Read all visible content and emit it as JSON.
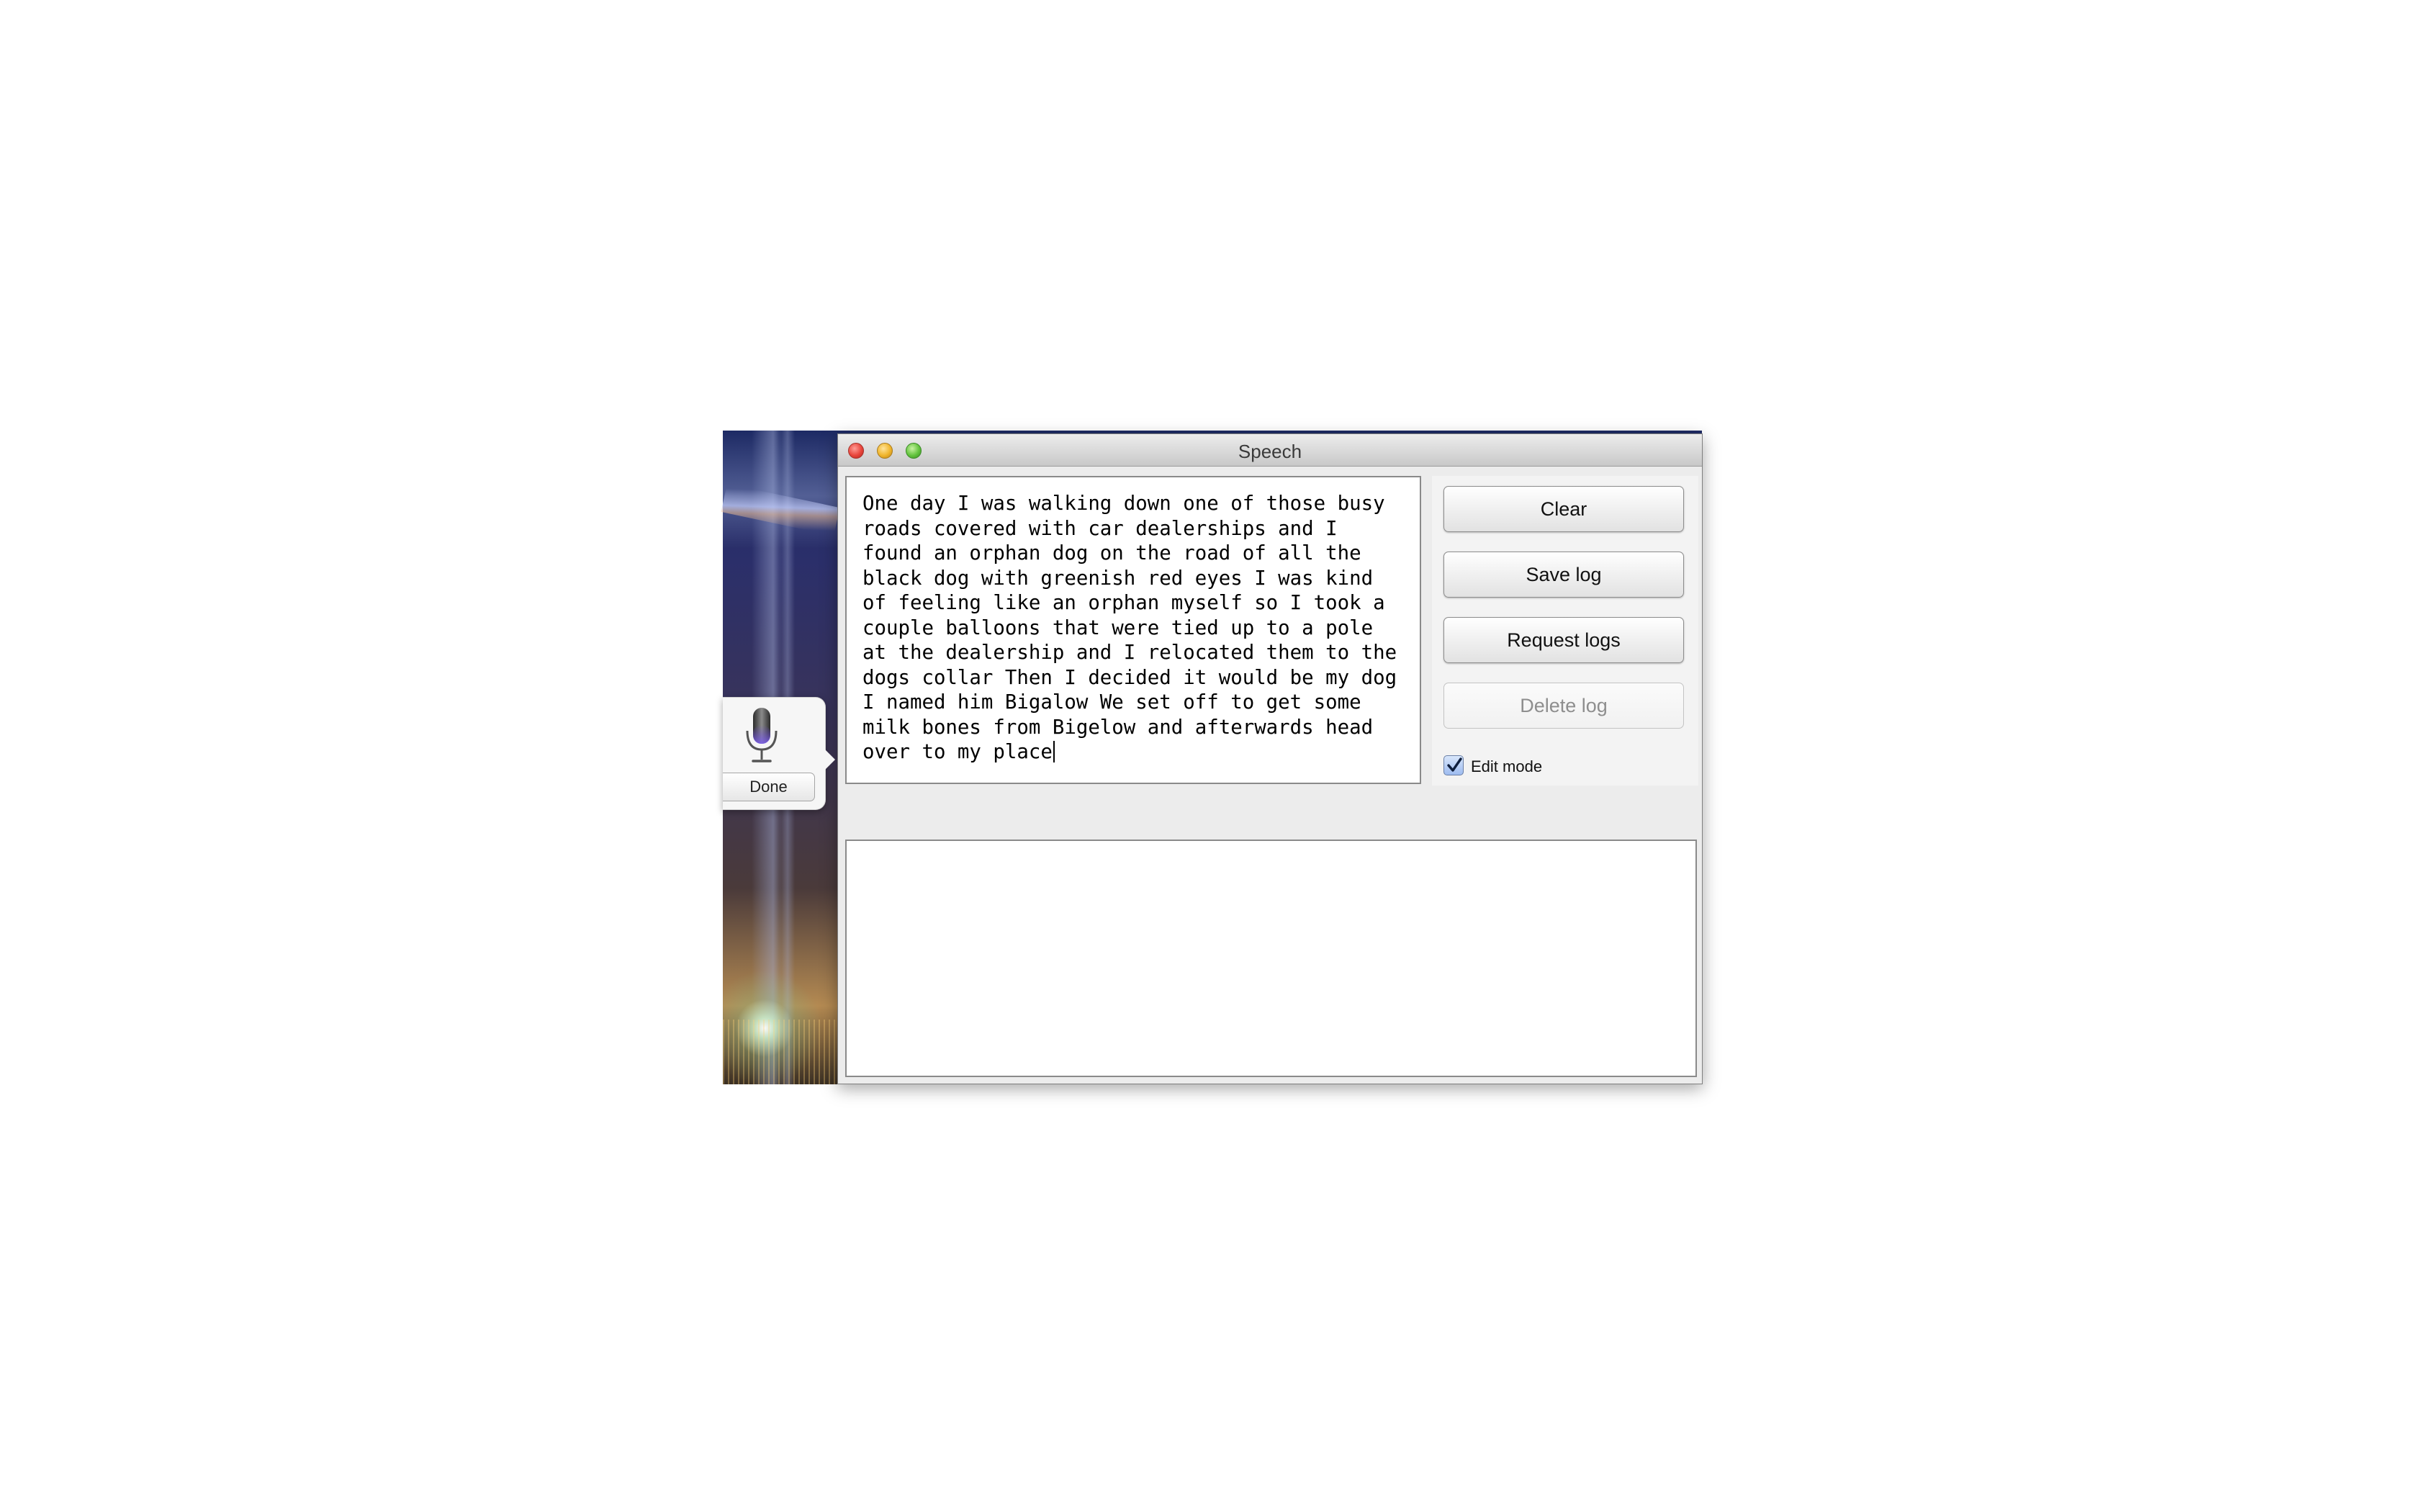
{
  "window": {
    "title": "Speech"
  },
  "editor": {
    "text": "One day I was walking down one of those busy roads covered with car dealerships and I found an orphan dog on the road of all the black dog with greenish red eyes I was kind of feeling like an orphan myself so I took a couple balloons that were tied up to a pole at the dealership and I relocated them to the dogs collar Then I decided it would be my dog I named him Bigalow We set off to get some milk bones from Bigelow and afterwards head over to my place"
  },
  "controls": {
    "clear_label": "Clear",
    "save_log_label": "Save log",
    "request_logs_label": "Request logs",
    "delete_log_label": "Delete log",
    "edit_mode_label": "Edit mode",
    "edit_mode_checked": true
  },
  "log": {
    "text": ""
  },
  "dictation": {
    "done_label": "Done"
  },
  "icons": {
    "dictation": "microphone-icon",
    "edit_mode": "checkmark-icon"
  },
  "colors": {
    "close": "#e8453c",
    "minimize": "#f0b52b",
    "zoom": "#62c33d",
    "checkbox": "#9ebcf0"
  }
}
